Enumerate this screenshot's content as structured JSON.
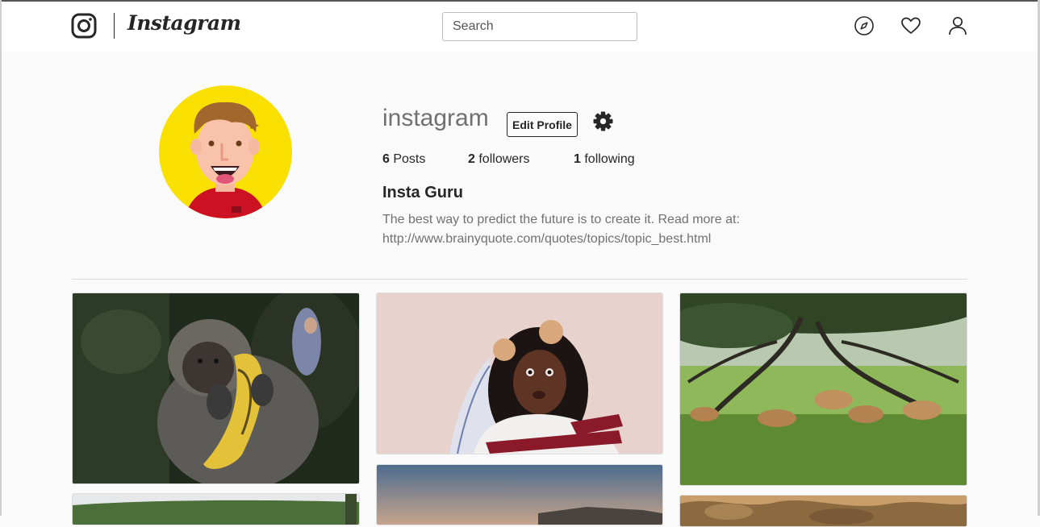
{
  "header": {
    "brand": "Instagram",
    "search": {
      "placeholder": "Search",
      "value": ""
    },
    "icons": [
      "compass-icon",
      "heart-icon",
      "user-icon"
    ]
  },
  "profile": {
    "username": "instagram",
    "edit_label": "Edit Profile",
    "settings_icon": "gear-icon",
    "stats": [
      {
        "count": "6",
        "label": "Posts"
      },
      {
        "count": "2",
        "label": "followers"
      },
      {
        "count": "1",
        "label": "following"
      }
    ],
    "name": "Insta Guru",
    "bio_line1": "The best way to predict the future is to create it. Read more at:",
    "bio_line2": "http://www.brainyquote.com/quotes/topics/topic_best.html"
  },
  "colors": {
    "avatar_bg": "#f9e000",
    "page_bg": "#fafafa",
    "muted_text": "#717171"
  }
}
